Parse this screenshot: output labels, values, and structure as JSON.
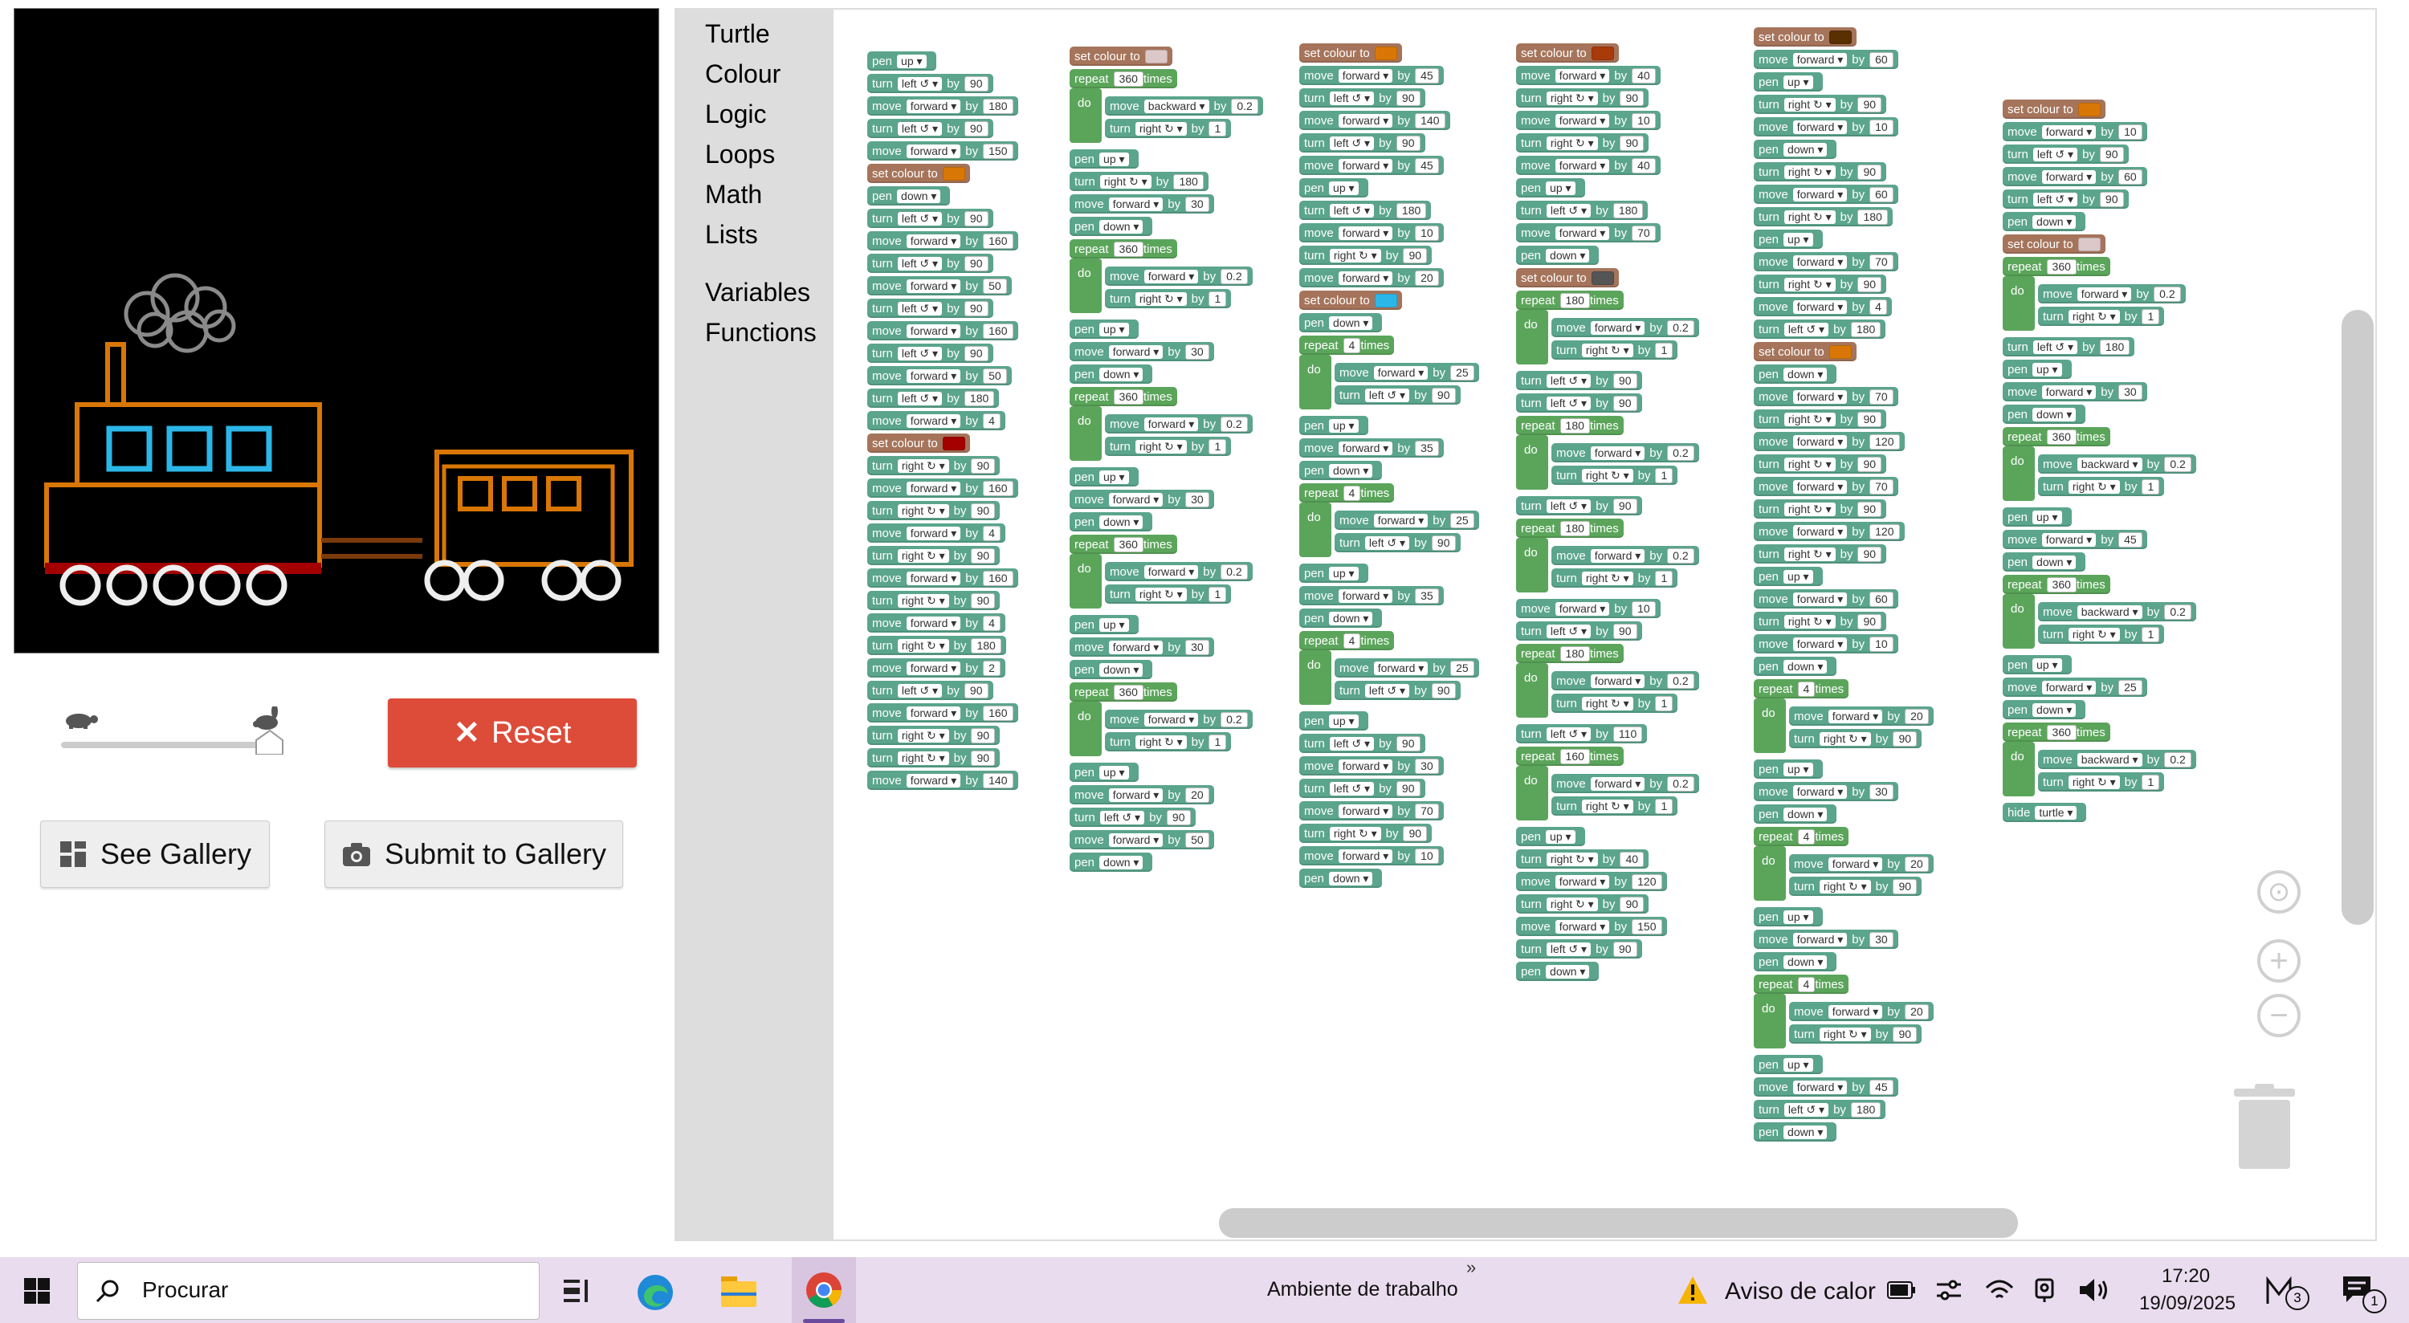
{
  "toolbox": {
    "categories": [
      "Turtle",
      "Colour",
      "Logic",
      "Loops",
      "Math",
      "Lists"
    ],
    "extra": [
      "Variables",
      "Functions"
    ]
  },
  "buttons": {
    "reset": "Reset",
    "see_gallery": "See Gallery",
    "submit_gallery": "Submit to Gallery"
  },
  "turtle_colors": {
    "smoke": "#8a8a8a",
    "body": "#d97706",
    "windows": "#2ab7e8",
    "chassis": "#a40000",
    "link": "#7a3a0c",
    "wheels": "#eeeeee"
  },
  "speed": {
    "value": 1.0
  },
  "blocks": {
    "pen": "pen",
    "move": "move",
    "turn": "turn",
    "by": "by",
    "set_colour": "set colour to",
    "repeat": "repeat",
    "times": "times",
    "do": "do",
    "hide": "hide",
    "turtle": "turtle",
    "up": "up",
    "down": "down",
    "forward": "forward",
    "backward": "backward",
    "left": "left ↺",
    "right": "right ↻"
  },
  "program": {
    "col1": [
      [
        "pen",
        "up"
      ],
      [
        "turn",
        "left ↺",
        "90"
      ],
      [
        "move",
        "forward",
        "180"
      ],
      [
        "turn",
        "left ↺",
        "90"
      ],
      [
        "move",
        "forward",
        "150"
      ],
      [
        "colour",
        "#d97706"
      ],
      [
        "pen",
        "down"
      ],
      [
        "turn",
        "left ↺",
        "90"
      ],
      [
        "move",
        "forward",
        "160"
      ],
      [
        "turn",
        "left ↺",
        "90"
      ],
      [
        "move",
        "forward",
        "50"
      ],
      [
        "turn",
        "left ↺",
        "90"
      ],
      [
        "move",
        "forward",
        "160"
      ],
      [
        "turn",
        "left ↺",
        "90"
      ],
      [
        "move",
        "forward",
        "50"
      ],
      [
        "turn",
        "left ↺",
        "180"
      ],
      [
        "move",
        "forward",
        "4"
      ],
      [
        "colour",
        "#a40000"
      ],
      [
        "turn",
        "right ↻",
        "90"
      ],
      [
        "move",
        "forward",
        "160"
      ],
      [
        "turn",
        "right ↻",
        "90"
      ],
      [
        "move",
        "forward",
        "4"
      ],
      [
        "turn",
        "right ↻",
        "90"
      ],
      [
        "move",
        "forward",
        "160"
      ],
      [
        "turn",
        "right ↻",
        "90"
      ],
      [
        "move",
        "forward",
        "4"
      ],
      [
        "turn",
        "right ↻",
        "180"
      ],
      [
        "move",
        "forward",
        "2"
      ],
      [
        "turn",
        "left ↺",
        "90"
      ],
      [
        "move",
        "forward",
        "160"
      ],
      [
        "turn",
        "right ↻",
        "90"
      ],
      [
        "turn",
        "right ↻",
        "90"
      ],
      [
        "move",
        "forward",
        "140"
      ]
    ],
    "col2": [
      [
        "colour",
        "#dcc8c8"
      ],
      [
        "repeat",
        "360"
      ],
      [
        "move",
        "backward",
        "0.2"
      ],
      [
        "turn",
        "right ↻",
        "1"
      ],
      [
        "pen",
        "up"
      ],
      [
        "turn",
        "right ↻",
        "180"
      ],
      [
        "move",
        "forward",
        "30"
      ],
      [
        "pen",
        "down"
      ],
      [
        "repeat",
        "360"
      ],
      [
        "move",
        "forward",
        "0.2"
      ],
      [
        "turn",
        "right ↻",
        "1"
      ],
      [
        "pen",
        "up"
      ],
      [
        "move",
        "forward",
        "30"
      ],
      [
        "pen",
        "down"
      ],
      [
        "repeat",
        "360"
      ],
      [
        "move",
        "forward",
        "0.2"
      ],
      [
        "turn",
        "right ↻",
        "1"
      ],
      [
        "pen",
        "up"
      ],
      [
        "move",
        "forward",
        "30"
      ],
      [
        "pen",
        "down"
      ],
      [
        "repeat",
        "360"
      ],
      [
        "move",
        "forward",
        "0.2"
      ],
      [
        "turn",
        "right ↻",
        "1"
      ],
      [
        "pen",
        "up"
      ],
      [
        "move",
        "forward",
        "30"
      ],
      [
        "pen",
        "down"
      ],
      [
        "repeat",
        "360"
      ],
      [
        "move",
        "forward",
        "0.2"
      ],
      [
        "turn",
        "right ↻",
        "1"
      ],
      [
        "pen",
        "up"
      ],
      [
        "move",
        "forward",
        "20"
      ],
      [
        "turn",
        "left ↺",
        "90"
      ],
      [
        "move",
        "forward",
        "50"
      ],
      [
        "pen",
        "down"
      ]
    ],
    "col3": [
      [
        "colour",
        "#d97706"
      ],
      [
        "move",
        "forward",
        "45"
      ],
      [
        "turn",
        "left ↺",
        "90"
      ],
      [
        "move",
        "forward",
        "140"
      ],
      [
        "turn",
        "left ↺",
        "90"
      ],
      [
        "move",
        "forward",
        "45"
      ],
      [
        "pen",
        "up"
      ],
      [
        "turn",
        "left ↺",
        "180"
      ],
      [
        "move",
        "forward",
        "10"
      ],
      [
        "turn",
        "right ↻",
        "90"
      ],
      [
        "move",
        "forward",
        "20"
      ],
      [
        "colour",
        "#2ab7e8"
      ],
      [
        "pen",
        "down"
      ],
      [
        "repeat",
        "4"
      ],
      [
        "move",
        "forward",
        "25"
      ],
      [
        "turn",
        "left ↺",
        "90"
      ],
      [
        "pen",
        "up"
      ],
      [
        "move",
        "forward",
        "35"
      ],
      [
        "pen",
        "down"
      ],
      [
        "repeat",
        "4"
      ],
      [
        "move",
        "forward",
        "25"
      ],
      [
        "turn",
        "left ↺",
        "90"
      ],
      [
        "pen",
        "up"
      ],
      [
        "move",
        "forward",
        "35"
      ],
      [
        "pen",
        "down"
      ],
      [
        "repeat",
        "4"
      ],
      [
        "move",
        "forward",
        "25"
      ],
      [
        "turn",
        "left ↺",
        "90"
      ],
      [
        "pen",
        "up"
      ],
      [
        "turn",
        "left ↺",
        "90"
      ],
      [
        "move",
        "forward",
        "30"
      ],
      [
        "turn",
        "left ↺",
        "90"
      ],
      [
        "move",
        "forward",
        "70"
      ],
      [
        "turn",
        "right ↻",
        "90"
      ],
      [
        "move",
        "forward",
        "10"
      ],
      [
        "pen",
        "down"
      ]
    ],
    "col4": [
      [
        "colour",
        "#a93a0a"
      ],
      [
        "move",
        "forward",
        "40"
      ],
      [
        "turn",
        "right ↻",
        "90"
      ],
      [
        "move",
        "forward",
        "10"
      ],
      [
        "turn",
        "right ↻",
        "90"
      ],
      [
        "move",
        "forward",
        "40"
      ],
      [
        "pen",
        "up"
      ],
      [
        "turn",
        "left ↺",
        "180"
      ],
      [
        "move",
        "forward",
        "70"
      ],
      [
        "pen",
        "down"
      ],
      [
        "colour",
        "#555555"
      ],
      [
        "repeat",
        "180"
      ],
      [
        "move",
        "forward",
        "0.2"
      ],
      [
        "turn",
        "right ↻",
        "1"
      ],
      [
        "turn",
        "left ↺",
        "90"
      ],
      [
        "turn",
        "left ↺",
        "90"
      ],
      [
        "repeat",
        "180"
      ],
      [
        "move",
        "forward",
        "0.2"
      ],
      [
        "turn",
        "right ↻",
        "1"
      ],
      [
        "turn",
        "left ↺",
        "90"
      ],
      [
        "repeat",
        "180"
      ],
      [
        "move",
        "forward",
        "0.2"
      ],
      [
        "turn",
        "right ↻",
        "1"
      ],
      [
        "move",
        "forward",
        "10"
      ],
      [
        "turn",
        "left ↺",
        "90"
      ],
      [
        "repeat",
        "180"
      ],
      [
        "move",
        "forward",
        "0.2"
      ],
      [
        "turn",
        "right ↻",
        "1"
      ],
      [
        "turn",
        "left ↺",
        "110"
      ],
      [
        "repeat",
        "160"
      ],
      [
        "move",
        "forward",
        "0.2"
      ],
      [
        "turn",
        "right ↻",
        "1"
      ],
      [
        "pen",
        "up"
      ],
      [
        "turn",
        "right ↻",
        "40"
      ],
      [
        "move",
        "forward",
        "120"
      ],
      [
        "turn",
        "right ↻",
        "90"
      ],
      [
        "move",
        "forward",
        "150"
      ],
      [
        "turn",
        "left ↺",
        "90"
      ],
      [
        "pen",
        "down"
      ]
    ],
    "col5": [
      [
        "colour",
        "#5a3000"
      ],
      [
        "move",
        "forward",
        "60"
      ],
      [
        "pen",
        "up"
      ],
      [
        "turn",
        "right ↻",
        "90"
      ],
      [
        "move",
        "forward",
        "10"
      ],
      [
        "pen",
        "down"
      ],
      [
        "turn",
        "right ↻",
        "90"
      ],
      [
        "move",
        "forward",
        "60"
      ],
      [
        "turn",
        "right ↻",
        "180"
      ],
      [
        "pen",
        "up"
      ],
      [
        "move",
        "forward",
        "70"
      ],
      [
        "turn",
        "right ↻",
        "90"
      ],
      [
        "move",
        "forward",
        "4"
      ],
      [
        "turn",
        "left ↺",
        "180"
      ],
      [
        "colour",
        "#d97706"
      ],
      [
        "pen",
        "down"
      ],
      [
        "move",
        "forward",
        "70"
      ],
      [
        "turn",
        "right ↻",
        "90"
      ],
      [
        "move",
        "forward",
        "120"
      ],
      [
        "turn",
        "right ↻",
        "90"
      ],
      [
        "move",
        "forward",
        "70"
      ],
      [
        "turn",
        "right ↻",
        "90"
      ],
      [
        "move",
        "forward",
        "120"
      ],
      [
        "turn",
        "right ↻",
        "90"
      ],
      [
        "pen",
        "up"
      ],
      [
        "move",
        "forward",
        "60"
      ],
      [
        "turn",
        "right ↻",
        "90"
      ],
      [
        "move",
        "forward",
        "10"
      ],
      [
        "pen",
        "down"
      ],
      [
        "repeat",
        "4"
      ],
      [
        "move",
        "forward",
        "20"
      ],
      [
        "turn",
        "right ↻",
        "90"
      ],
      [
        "pen",
        "up"
      ],
      [
        "move",
        "forward",
        "30"
      ],
      [
        "pen",
        "down"
      ],
      [
        "repeat",
        "4"
      ],
      [
        "move",
        "forward",
        "20"
      ],
      [
        "turn",
        "right ↻",
        "90"
      ],
      [
        "pen",
        "up"
      ],
      [
        "move",
        "forward",
        "30"
      ],
      [
        "pen",
        "down"
      ],
      [
        "repeat",
        "4"
      ],
      [
        "move",
        "forward",
        "20"
      ],
      [
        "turn",
        "right ↻",
        "90"
      ],
      [
        "pen",
        "up"
      ],
      [
        "move",
        "forward",
        "45"
      ],
      [
        "turn",
        "left ↺",
        "180"
      ],
      [
        "pen",
        "down"
      ]
    ],
    "col6": [
      [
        "colour",
        "#d97706"
      ],
      [
        "move",
        "forward",
        "10"
      ],
      [
        "turn",
        "left ↺",
        "90"
      ],
      [
        "move",
        "forward",
        "60"
      ],
      [
        "turn",
        "left ↺",
        "90"
      ],
      [
        "pen",
        "down"
      ],
      [
        "colour",
        "#dcc8c8"
      ],
      [
        "repeat",
        "360"
      ],
      [
        "move",
        "forward",
        "0.2"
      ],
      [
        "turn",
        "right ↻",
        "1"
      ],
      [
        "turn",
        "left ↺",
        "180"
      ],
      [
        "pen",
        "up"
      ],
      [
        "move",
        "forward",
        "30"
      ],
      [
        "pen",
        "down"
      ],
      [
        "repeat",
        "360"
      ],
      [
        "move",
        "backward",
        "0.2"
      ],
      [
        "turn",
        "right ↻",
        "1"
      ],
      [
        "pen",
        "up"
      ],
      [
        "move",
        "forward",
        "45"
      ],
      [
        "pen",
        "down"
      ],
      [
        "repeat",
        "360"
      ],
      [
        "move",
        "backward",
        "0.2"
      ],
      [
        "turn",
        "right ↻",
        "1"
      ],
      [
        "pen",
        "up"
      ],
      [
        "move",
        "forward",
        "25"
      ],
      [
        "pen",
        "down"
      ],
      [
        "repeat",
        "360"
      ],
      [
        "move",
        "backward",
        "0.2"
      ],
      [
        "turn",
        "right ↻",
        "1"
      ],
      [
        "hide"
      ]
    ]
  },
  "taskbar": {
    "search": "Procurar",
    "desktop": "Ambiente de trabalho",
    "heat_warning": "Aviso de calor",
    "time": "17:20",
    "date": "19/09/2025",
    "mail_badge": "3",
    "notif_badge": "1"
  }
}
